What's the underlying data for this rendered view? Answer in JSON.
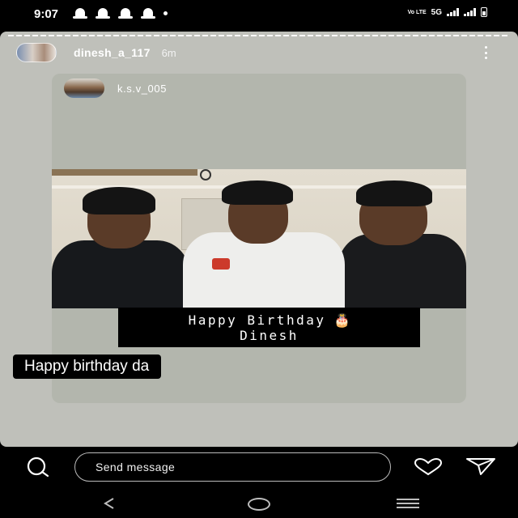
{
  "status_bar": {
    "time": "9:07",
    "volte": "Vo LTE",
    "network": "5G"
  },
  "story": {
    "username": "dinesh_a_117",
    "timestamp": "6m",
    "shared_post": {
      "username": "k.s.v_005",
      "caption_line1": "Happy Birthday",
      "caption_line2": "Dinesh",
      "caption_emoji": "🎂"
    },
    "reply_text": "Happy birthday da"
  },
  "reply_bar": {
    "placeholder": "Send message"
  },
  "icons": {
    "camera": "camera-icon",
    "heart": "heart-icon",
    "send": "send-icon",
    "more": "more-options-icon",
    "back": "nav-back-icon",
    "home": "nav-home-icon",
    "recents": "nav-recents-icon"
  },
  "colors": {
    "story_background": "#bfc0ba",
    "card_background": "#b3b6ad",
    "caption_background": "#000000"
  }
}
